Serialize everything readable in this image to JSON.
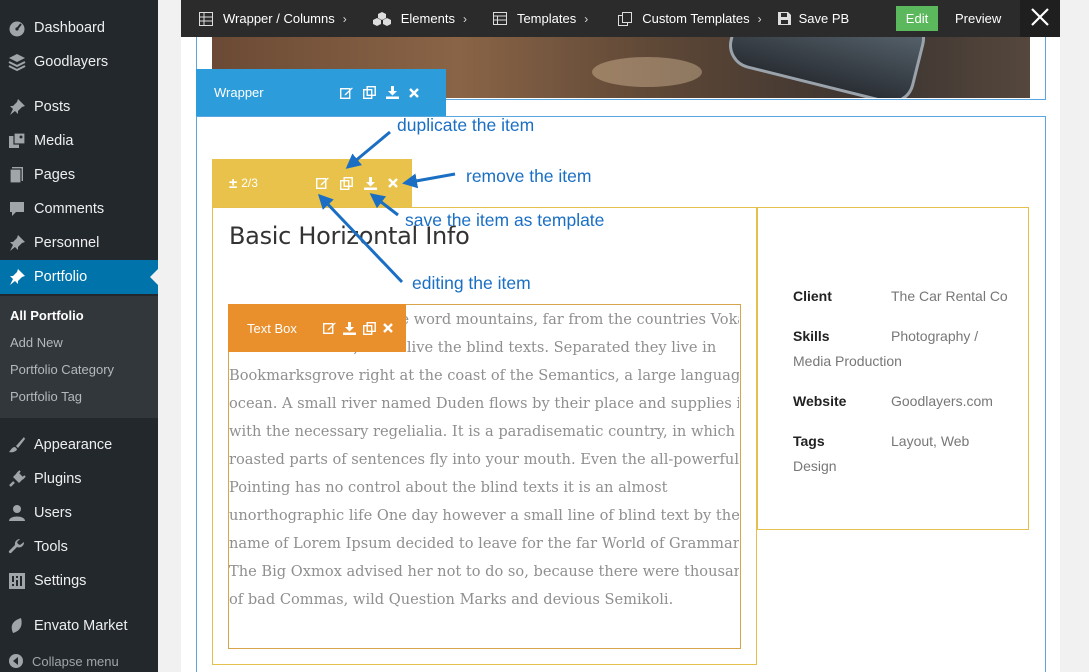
{
  "admin_menu": {
    "items": [
      {
        "label": "Dashboard",
        "icon": "dashboard-icon"
      },
      {
        "label": "Goodlayers",
        "icon": "layers-icon"
      },
      {
        "label": "Posts",
        "icon": "pin-icon"
      },
      {
        "label": "Media",
        "icon": "media-icon"
      },
      {
        "label": "Pages",
        "icon": "page-icon"
      },
      {
        "label": "Comments",
        "icon": "comment-icon"
      },
      {
        "label": "Personnel",
        "icon": "pin-icon"
      },
      {
        "label": "Portfolio",
        "icon": "pin-icon",
        "active": true
      },
      {
        "label": "Appearance",
        "icon": "brush-icon"
      },
      {
        "label": "Plugins",
        "icon": "plug-icon"
      },
      {
        "label": "Users",
        "icon": "user-icon"
      },
      {
        "label": "Tools",
        "icon": "wrench-icon"
      },
      {
        "label": "Settings",
        "icon": "sliders-icon"
      },
      {
        "label": "Envato Market",
        "icon": "leaf-icon"
      }
    ],
    "submenu": [
      {
        "label": "All Portfolio",
        "current": true
      },
      {
        "label": "Add New"
      },
      {
        "label": "Portfolio Category"
      },
      {
        "label": "Portfolio Tag"
      }
    ],
    "collapse_label": "Collapse menu",
    "active_color": "#0073aa",
    "background_color": "#23282d"
  },
  "toolbar": {
    "items": [
      {
        "label": "Wrapper / Columns",
        "icon": "grid-icon"
      },
      {
        "label": "Elements",
        "icon": "cubes-icon"
      },
      {
        "label": "Templates",
        "icon": "table-icon"
      },
      {
        "label": "Custom Templates",
        "icon": "copy-icon"
      }
    ],
    "save_label": "Save PB",
    "edit_label": "Edit",
    "preview_label": "Preview",
    "edit_color": "#5cb85c"
  },
  "builder": {
    "wrapper_label": "Wrapper",
    "wrapper_color": "#2d9cdb",
    "column_size": "2/3",
    "column_color": "#e8c24a",
    "item_title": "Basic Horizontal Info",
    "textbox_label": "Text Box",
    "textbox_color": "#e98f2b",
    "text_lines": [
      "Far far away, behind the word mountains, far from the countries Vokalia",
      "and Consonantia, there live the blind texts. Separated they live in",
      "Bookmarksgrove right at the coast of the Semantics, a large language",
      "ocean. A small river named Duden flows by their place and supplies it",
      "with the necessary regelialia. It is a paradisematic country, in which",
      "roasted parts of sentences fly into your mouth. Even the all-powerful",
      "Pointing has no control about the blind texts it is an almost",
      "unorthographic life One day however a small line of blind text by the",
      "name of Lorem Ipsum decided to leave for the far World of Grammar.",
      "The Big Oxmox advised her not to do so, because there were thousands",
      "of bad Commas, wild Question Marks and devious Semikoli."
    ],
    "meta": {
      "client_key": "Client",
      "client_value": "The Car Rental Co",
      "skills_key": "Skills",
      "skills_value_1": "Photography /",
      "skills_value_2": "Media Production",
      "website_key": "Website",
      "website_value": "Goodlayers.com",
      "tags_key": "Tags",
      "tags_value_1": "Layout, Web",
      "tags_value_2": "Design"
    }
  },
  "annotations": {
    "duplicate": "duplicate the item",
    "remove": "remove the item",
    "save": "save the item as template",
    "edit": "editing the item",
    "color": "#1a6fc4"
  }
}
